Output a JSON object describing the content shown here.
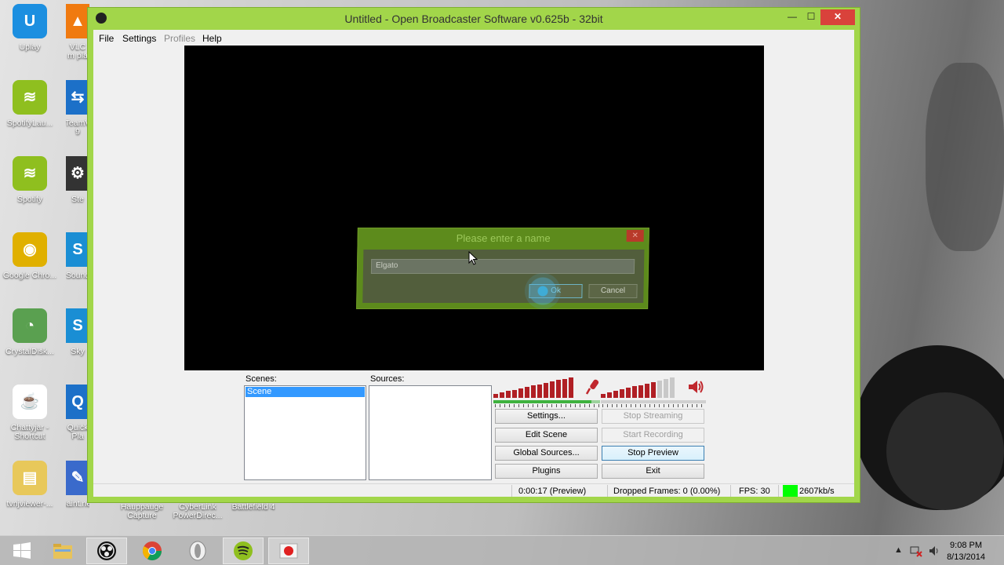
{
  "desktop": {
    "icons_left": [
      {
        "label": "Uplay",
        "icon": "uplay-icon",
        "color": "#1c8fe0"
      },
      {
        "label": "SpotifyLau...",
        "icon": "spotify-icon",
        "color": "#8fbf1f"
      },
      {
        "label": "Spotify",
        "icon": "spotify-icon",
        "color": "#8fbf1f"
      },
      {
        "label": "Google Chro...",
        "icon": "chrome-icon",
        "color": "#e0b000"
      },
      {
        "label": "CrystalDisk...",
        "icon": "crystaldisk-icon",
        "color": "#5aa050"
      },
      {
        "label": "Chattyjar - Shortcut",
        "icon": "java-icon",
        "color": "#ffffff"
      },
      {
        "label": "tvnjviewer-...",
        "icon": "folder-icon",
        "color": "#e8c85a"
      }
    ],
    "icons_second": [
      {
        "label": "VLC m pla",
        "icon": "vlc-icon",
        "color": "#f07a10"
      },
      {
        "label": "TeamV 9",
        "icon": "teamviewer-icon",
        "color": "#1c70c8"
      },
      {
        "label": "Ste",
        "icon": "steam-icon",
        "color": "#333333"
      },
      {
        "label": "Sound",
        "icon": "skype-icon",
        "color": "#1a8ed4"
      },
      {
        "label": "Sky",
        "icon": "skype-icon",
        "color": "#1a8ed4"
      },
      {
        "label": "Quick Pla",
        "icon": "quicktime-icon",
        "color": "#1c70c8"
      },
      {
        "label": "paint.net",
        "icon": "paintnet-icon",
        "color": "#3a6acb"
      }
    ],
    "icons_bottom": [
      "Hauppauge Capture",
      "CyberLink PowerDirec...",
      "Battlefield 4"
    ]
  },
  "window": {
    "title": "Untitled - Open Broadcaster Software v0.625b - 32bit",
    "minimize": "—",
    "maximize": "☐",
    "close": "✕"
  },
  "menu": {
    "file": "File",
    "settings": "Settings",
    "profiles": "Profiles",
    "help": "Help"
  },
  "ghost_dialog": {
    "title": "Please enter a name",
    "input_value": "Elgato",
    "ok": "Ok",
    "cancel": "Cancel"
  },
  "panel": {
    "scenes_label": "Scenes:",
    "scenes": [
      "Scene"
    ],
    "sources_label": "Sources:",
    "buttons": {
      "settings": "Settings...",
      "edit_scene": "Edit Scene",
      "global_sources": "Global Sources...",
      "plugins": "Plugins",
      "stop_streaming": "Stop Streaming",
      "start_recording": "Start Recording",
      "stop_preview": "Stop Preview",
      "exit": "Exit"
    },
    "mic_meter_level": 1.0,
    "desktop_meter_level": 0.75,
    "meter_color": "#b01f24"
  },
  "status": {
    "time": "0:00:17 (Preview)",
    "dropped_frames": "Dropped Frames: 0 (0.00%)",
    "fps": "FPS: 30",
    "bitrate": "2607kb/s",
    "bitrate_color": "#00ff00"
  },
  "taskbar": {
    "apps": [
      "start-icon",
      "file-explorer-icon",
      "obs-icon",
      "chrome-icon",
      "opera-icon",
      "spotify-icon",
      "recorder-icon"
    ],
    "time": "9:08 PM",
    "date": "8/13/2014",
    "tray_arrow": "▲"
  },
  "colors": {
    "window_frame": "#a2d64a",
    "selection": "#3399ff"
  }
}
